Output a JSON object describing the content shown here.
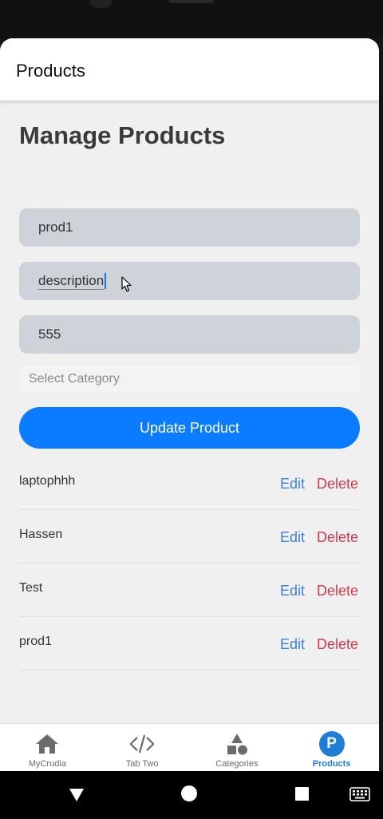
{
  "header": {
    "title": "Products"
  },
  "form": {
    "heading": "Manage Products",
    "name_value": "prod1",
    "description_value": "description",
    "price_value": "555",
    "category_placeholder": "Select Category",
    "submit_label": "Update Product"
  },
  "products": [
    {
      "name": "laptophhh",
      "edit": "Edit",
      "delete": "Delete"
    },
    {
      "name": "Hassen",
      "edit": "Edit",
      "delete": "Delete"
    },
    {
      "name": "Test",
      "edit": "Edit",
      "delete": "Delete"
    },
    {
      "name": "prod1",
      "edit": "Edit",
      "delete": "Delete"
    }
  ],
  "tabs": [
    {
      "label": "MyCrudia",
      "icon": "home-icon"
    },
    {
      "label": "Tab Two",
      "icon": "code-icon"
    },
    {
      "label": "Categories",
      "icon": "shapes-icon"
    },
    {
      "label": "Products",
      "icon": "p-circle-icon",
      "icon_text": "P",
      "active": true
    }
  ],
  "colors": {
    "accent": "#0a7cff",
    "edit": "#3b82d6",
    "delete": "#d13a4d",
    "active_tab": "#1f7ed8"
  }
}
